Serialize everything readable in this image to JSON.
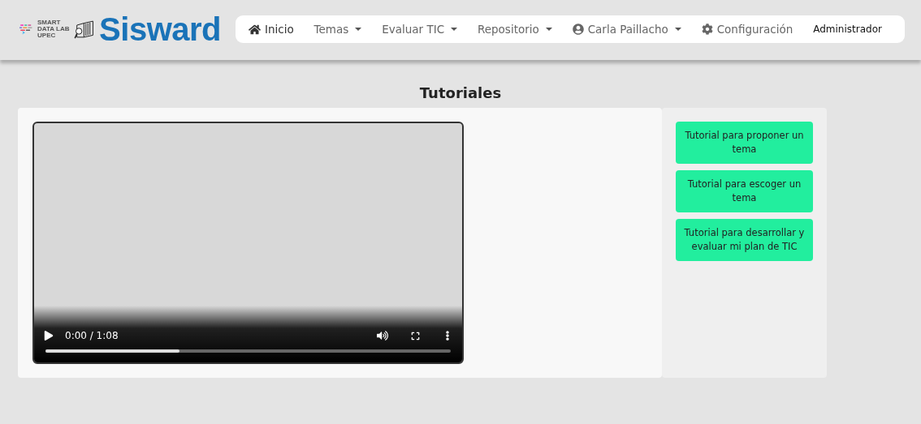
{
  "brand": {
    "lab_lines": [
      "SMART",
      "DATA LAB",
      "UPEC"
    ],
    "name": "Sisward"
  },
  "nav": [
    {
      "label": "Inicio",
      "kind": "home",
      "dropdown": false
    },
    {
      "label": "Temas",
      "kind": "plain",
      "dropdown": true
    },
    {
      "label": "Evaluar TIC",
      "kind": "plain",
      "dropdown": true
    },
    {
      "label": "Repositorio",
      "kind": "plain",
      "dropdown": true
    },
    {
      "label": "Carla Paillacho",
      "kind": "user",
      "dropdown": true
    },
    {
      "label": "Configuración",
      "kind": "settings",
      "dropdown": false
    },
    {
      "label": "Administrador",
      "kind": "role",
      "dropdown": false
    }
  ],
  "page_title": "Tutoriales",
  "video": {
    "time": "0:00 / 1:08",
    "level": 0.33
  },
  "tutorials": [
    "Tutorial para proponer un tema",
    "Tutorial para escoger un tema",
    "Tutorial para desarrollar y evaluar mi plan de TIC"
  ]
}
